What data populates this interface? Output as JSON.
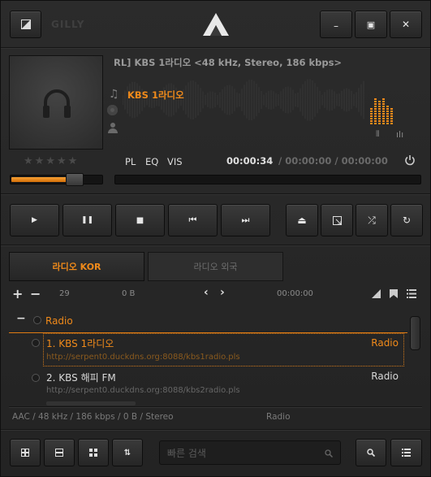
{
  "titlebar": {
    "skin_name": "GILLY",
    "min_symbol": "–",
    "max_symbol": "▣",
    "close_symbol": "✕"
  },
  "nowplaying": {
    "scroll_title": "RL] KBS 1라디오 <48 kHz, Stereo, 186 kbps>",
    "track_title": "KBS 1라디오",
    "tabs": [
      "PL",
      "EQ",
      "VIS"
    ],
    "elapsed": "00:00:34",
    "time_rest": "/ 00:00:00 / 00:00:00",
    "rating_max": 5,
    "rating": 0,
    "volume": 0.75,
    "seek": 0.0,
    "spectrum": [
      0.62,
      0.95,
      0.8,
      0.9,
      0.7,
      0.55
    ]
  },
  "transport": {
    "play_symbol": "▶",
    "pause_symbol": "❚❚",
    "stop_symbol": "■",
    "prev_symbol": "⏮",
    "next_symbol": "⏭",
    "eject_symbol": "⏏",
    "shuffle_symbol": "⤮",
    "repeat_symbol": "↻"
  },
  "playlist_tabs": [
    {
      "label": "라디오 KOR",
      "active": true
    },
    {
      "label": "라디오 외국",
      "active": false
    }
  ],
  "playlist_info": {
    "add_symbol": "+",
    "remove_symbol": "−",
    "count": "29",
    "size": "0 B",
    "total_time": "00:00:00"
  },
  "playlist": {
    "group_label": "Radio",
    "items": [
      {
        "title": "1. KBS 1라디오",
        "url": "http://serpent0.duckdns.org:8088/kbs1radio.pls",
        "genre": "Radio",
        "active": true
      },
      {
        "title": "2. KBS 해피 FM",
        "url": "http://serpent0.duckdns.org:8088/kbs2radio.pls",
        "genre": "Radio",
        "active": false
      }
    ]
  },
  "statusbar": {
    "format": "AAC / 48 kHz / 186 kbps / 0 B / Stereo",
    "genre": "Radio"
  },
  "bottombar": {
    "search_placeholder": "빠른 검색"
  },
  "colors": {
    "accent": "#f08a1a",
    "background": "#252525"
  }
}
